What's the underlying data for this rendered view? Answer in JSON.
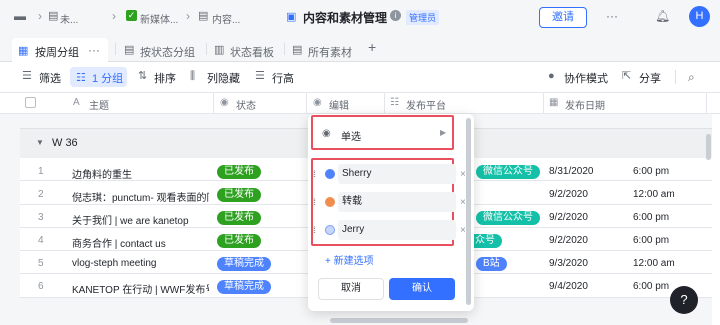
{
  "topbar": {
    "crumb1": "未...",
    "crumb2": "新媒体...",
    "crumb3": "内容...",
    "title": "内容和素材管理",
    "badge": "管理员",
    "invite": "邀请",
    "more": "···",
    "avatar": "H"
  },
  "tabs": [
    {
      "label": "按周分组",
      "more": "···"
    },
    {
      "label": "按状态分组"
    },
    {
      "label": "状态看板"
    },
    {
      "label": "所有素材"
    }
  ],
  "tab_add": "+",
  "toolbar": {
    "filter": "筛选",
    "group": "1 分组",
    "sort": "排序",
    "hide": "列隐藏",
    "rowheight": "行高",
    "collab": "协作模式",
    "share": "分享"
  },
  "columns": {
    "topic": "主题",
    "status": "状态",
    "editor": "编辑",
    "platform": "发布平台",
    "date": "发布日期"
  },
  "group": {
    "label": "W 36"
  },
  "rows": [
    {
      "n": "1",
      "topic": "边角料的重生",
      "status": "已发布",
      "platform": "微信公众号",
      "date": "8/31/2020",
      "time": "6:00 pm"
    },
    {
      "n": "2",
      "topic": "倪志琪：punctum- 观看表面的同",
      "status": "已发布",
      "platform": "",
      "date": "9/2/2020",
      "time": "12:00 am"
    },
    {
      "n": "3",
      "topic": "关于我们 | we are kanetop",
      "status": "已发布",
      "platform": "微信公众号",
      "date": "9/2/2020",
      "time": "6:00 pm"
    },
    {
      "n": "4",
      "topic": "商务合作 | contact us",
      "status": "已发布",
      "platform": "众号",
      "date": "9/2/2020",
      "time": "6:00 pm"
    },
    {
      "n": "5",
      "topic": "vlog-steph meeting",
      "status": "草稿完成",
      "platform": "B站",
      "date": "9/3/2020",
      "time": "12:00 am"
    },
    {
      "n": "6",
      "topic": "KANETOP 在行动 | WWF发布号",
      "status": "草稿完成",
      "platform": "",
      "date": "9/4/2020",
      "time": "6:00 pm"
    }
  ],
  "popup": {
    "type_label": "单选",
    "options": [
      {
        "label": "Sherry",
        "color": "#4e83fd"
      },
      {
        "label": "转载",
        "color": "#f08d4f"
      },
      {
        "label": "Jerry",
        "color": "#c7d7fb"
      }
    ],
    "add_option": "+ 新建选项",
    "cancel": "取消",
    "confirm": "确认"
  },
  "help": "?",
  "colors": {
    "accent": "#3370ff",
    "highlight": "#e84f5f"
  }
}
